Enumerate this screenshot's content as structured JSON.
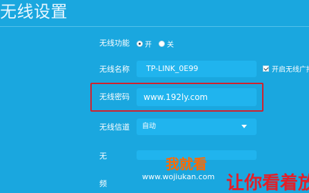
{
  "page": {
    "title": "无线设置"
  },
  "wireless": {
    "function_label": "无线功能",
    "on_label": "开",
    "off_label": "关",
    "name_label": "无线名称",
    "name_value": "TP-LINK_0E99",
    "broadcast_label": "开启无线广播",
    "password_label": "无线密码",
    "password_value": "www.192ly.com",
    "channel_label": "无线信道",
    "channel_value": "自动",
    "partial_label_1": "无",
    "partial_label_2": "频"
  },
  "watermark": {
    "logo_text": "我就看",
    "url": "www.wojiukan.com",
    "red_text": "让你看着放心"
  },
  "colors": {
    "background": "#1aa7df",
    "field": "#20b4ee",
    "highlight_box": "#d41f2a",
    "watermark_accent": "#ff6a00"
  }
}
